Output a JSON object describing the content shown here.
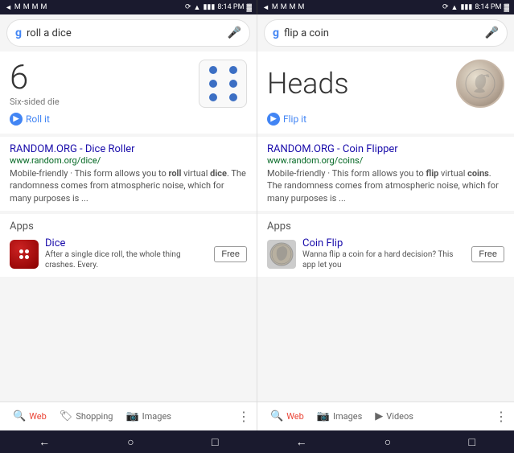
{
  "statusBar": {
    "time": "8:14 PM",
    "leftIcons": [
      "back-icon",
      "gmail-icon",
      "gmail2-icon",
      "gmail3-icon",
      "gmail4-icon"
    ],
    "rightIcons": [
      "sync-icon",
      "wifi-icon",
      "signal-icon",
      "battery-icon"
    ]
  },
  "leftPanel": {
    "search": {
      "query": "roll a dice",
      "placeholder": "roll a dice"
    },
    "diceResult": {
      "number": "6",
      "label": "Six-sided die"
    },
    "rollButton": "Roll it",
    "webResult": {
      "title": "RANDOM.ORG - Dice Roller",
      "url": "www.random.org/dice/",
      "description": "Mobile-friendly · This form allows you to roll virtual dice. The randomness comes from atmospheric noise, which for many purposes is ..."
    },
    "appsSection": {
      "label": "Apps",
      "app": {
        "name": "Dice",
        "description": "After a single dice roll, the whole thing crashes. Every.",
        "buttonLabel": "Free"
      }
    },
    "bottomNav": [
      {
        "label": "Web",
        "active": true
      },
      {
        "label": "Shopping"
      },
      {
        "label": "Images"
      },
      {
        "label": "more"
      }
    ]
  },
  "rightPanel": {
    "search": {
      "query": "flip a coin",
      "placeholder": "flip a coin"
    },
    "coinResult": {
      "text": "Heads"
    },
    "flipButton": "Flip it",
    "webResult": {
      "title": "RANDOM.ORG - Coin Flipper",
      "url": "www.random.org/coins/",
      "description": "Mobile-friendly · This form allows you to flip virtual coins. The randomness comes from atmospheric noise, which for many purposes is ..."
    },
    "appsSection": {
      "label": "Apps",
      "app": {
        "name": "Coin Flip",
        "description": "Wanna flip a coin for a hard decision? This app let you",
        "buttonLabel": "Free"
      }
    },
    "bottomNav": [
      {
        "label": "Web",
        "active": true
      },
      {
        "label": "Images"
      },
      {
        "label": "Videos"
      },
      {
        "label": "more"
      }
    ]
  },
  "systemNav": {
    "back": "←",
    "home": "○",
    "recent": "□"
  }
}
